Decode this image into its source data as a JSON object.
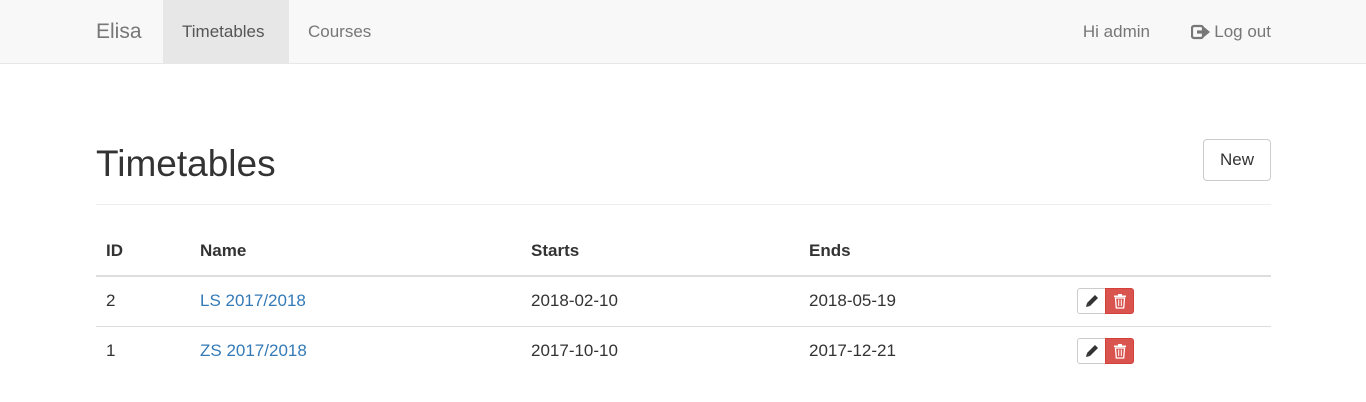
{
  "navbar": {
    "brand": "Elisa",
    "links": [
      {
        "label": "Timetables",
        "active": true
      },
      {
        "label": "Courses",
        "active": false
      }
    ],
    "greeting": "Hi admin",
    "logout_label": "Log out",
    "logout_icon": "log-out-icon"
  },
  "page": {
    "title": "Timetables",
    "new_button": "New"
  },
  "table": {
    "columns": [
      "ID",
      "Name",
      "Starts",
      "Ends"
    ],
    "rows": [
      {
        "id": "2",
        "name": "LS 2017/2018",
        "starts": "2018-02-10",
        "ends": "2018-05-19"
      },
      {
        "id": "1",
        "name": "ZS 2017/2018",
        "starts": "2017-10-10",
        "ends": "2017-12-21"
      }
    ],
    "row_actions": {
      "edit_icon": "pencil-icon",
      "delete_icon": "trash-icon"
    }
  },
  "colors": {
    "link": "#337ab7",
    "danger": "#d9534f",
    "navbar_bg": "#f8f8f8"
  }
}
